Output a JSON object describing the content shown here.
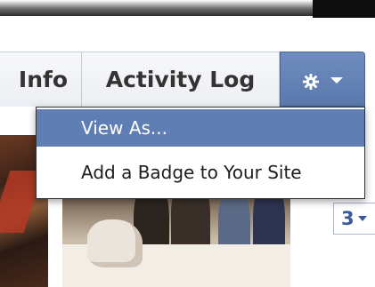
{
  "tabs": [
    {
      "label": "Info"
    },
    {
      "label": "Activity Log"
    }
  ],
  "settings_button": {
    "icon": "gear-icon",
    "caret": "caret-down-icon",
    "color": "#5f7eb3"
  },
  "dropdown": {
    "items": [
      {
        "label": "View As...",
        "highlighted": true
      },
      {
        "label": "Add a Badge to Your Site",
        "highlighted": false
      }
    ]
  },
  "photo_count": {
    "label": "3"
  }
}
